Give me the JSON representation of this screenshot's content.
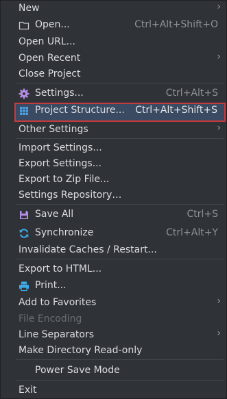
{
  "menu": {
    "items": [
      {
        "label": "New",
        "shortcut": "",
        "arrow": "›"
      },
      {
        "label": "Open...",
        "shortcut": "Ctrl+Alt+Shift+O",
        "icon": "folder-icon"
      },
      {
        "label": "Open URL...",
        "shortcut": ""
      },
      {
        "label": "Open Recent",
        "shortcut": "",
        "arrow": "›"
      },
      {
        "label": "Close Project",
        "shortcut": ""
      },
      {
        "label": "Settings...",
        "shortcut": "Ctrl+Alt+S",
        "icon": "gear-icon"
      },
      {
        "label": "Project Structure...",
        "shortcut": "Ctrl+Alt+Shift+S",
        "icon": "grid-icon",
        "selected": true
      },
      {
        "label": "Other Settings",
        "shortcut": "",
        "arrow": "›"
      },
      {
        "label": "Import Settings...",
        "shortcut": ""
      },
      {
        "label": "Export Settings...",
        "shortcut": ""
      },
      {
        "label": "Export to Zip File...",
        "shortcut": ""
      },
      {
        "label": "Settings Repository…",
        "shortcut": ""
      },
      {
        "label": "Save All",
        "shortcut": "Ctrl+S",
        "icon": "save-icon"
      },
      {
        "label": "Synchronize",
        "shortcut": "Ctrl+Alt+Y",
        "icon": "sync-icon"
      },
      {
        "label": "Invalidate Caches / Restart...",
        "shortcut": ""
      },
      {
        "label": "Export to HTML...",
        "shortcut": ""
      },
      {
        "label": "Print...",
        "shortcut": "",
        "icon": "printer-icon"
      },
      {
        "label": "Add to Favorites",
        "shortcut": "",
        "arrow": "›"
      },
      {
        "label": "File Encoding",
        "shortcut": "",
        "disabled": true
      },
      {
        "label": "Line Separators",
        "shortcut": "",
        "arrow": "›"
      },
      {
        "label": "Make Directory Read-only",
        "shortcut": ""
      },
      {
        "label": "Power Save Mode",
        "shortcut": ""
      },
      {
        "label": "Exit",
        "shortcut": ""
      }
    ]
  },
  "colors": {
    "background": "#2f3237",
    "selection": "#394a62",
    "highlight_border": "#c63b3e",
    "gear": "#b48ee6",
    "save": "#b48ee6",
    "sync": "#3fa9e6",
    "grid": "#4aa3e8",
    "printer": "#3fa9e6"
  }
}
